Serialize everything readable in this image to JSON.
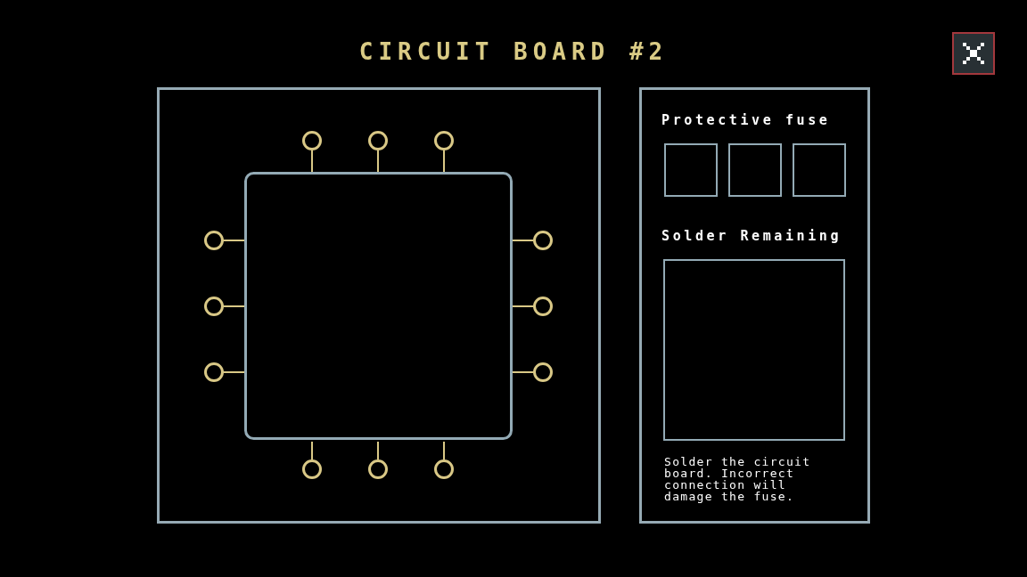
{
  "title": "CIRCUIT BOARD #2",
  "fuse": {
    "label": "Protective fuse",
    "slots": [
      {
        "filled": false
      },
      {
        "filled": false
      },
      {
        "filled": false
      }
    ]
  },
  "solder": {
    "label": "Solder Remaining"
  },
  "instructions": "Solder the circuit board. Incorrect connection will damage the fuse."
}
